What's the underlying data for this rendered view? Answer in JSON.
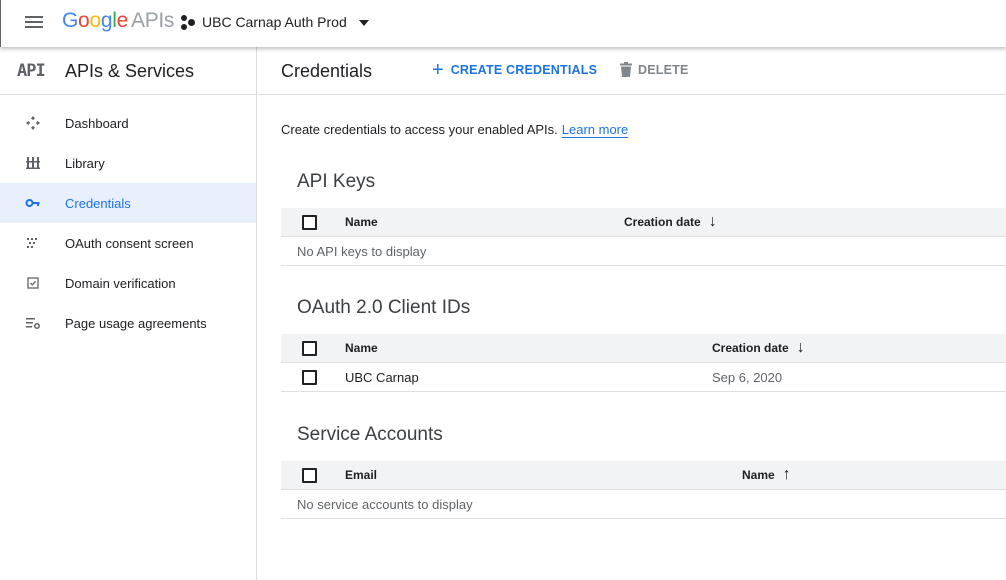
{
  "topbar": {
    "logo_letters": [
      "G",
      "o",
      "o",
      "g",
      "l",
      "e"
    ],
    "logo_suffix": "APIs",
    "project_name": "UBC Carnap Auth Prod"
  },
  "sidebar": {
    "badge": "API",
    "title": "APIs & Services",
    "items": [
      {
        "label": "Dashboard",
        "icon": "dashboard-icon"
      },
      {
        "label": "Library",
        "icon": "library-icon"
      },
      {
        "label": "Credentials",
        "icon": "key-icon",
        "active": true
      },
      {
        "label": "OAuth consent screen",
        "icon": "consent-icon"
      },
      {
        "label": "Domain verification",
        "icon": "domain-verification-icon"
      },
      {
        "label": "Page usage agreements",
        "icon": "settings-list-icon"
      }
    ]
  },
  "header": {
    "title": "Credentials",
    "create_label": "CREATE CREDENTIALS",
    "delete_label": "DELETE"
  },
  "intro": {
    "text": "Create credentials to access your enabled APIs.",
    "link": "Learn more"
  },
  "api_keys": {
    "title": "API Keys",
    "col_name": "Name",
    "col_date": "Creation date",
    "empty": "No API keys to display"
  },
  "oauth": {
    "title": "OAuth 2.0 Client IDs",
    "col_name": "Name",
    "col_date": "Creation date",
    "rows": [
      {
        "name": "UBC Carnap",
        "date": "Sep 6, 2020"
      }
    ]
  },
  "service_accounts": {
    "title": "Service Accounts",
    "col_email": "Email",
    "col_name": "Name",
    "empty": "No service accounts to display"
  },
  "colors": {
    "accent": "#1a73e8",
    "active_bg": "#e8f0fe",
    "table_header_bg": "#f1f3f4"
  }
}
